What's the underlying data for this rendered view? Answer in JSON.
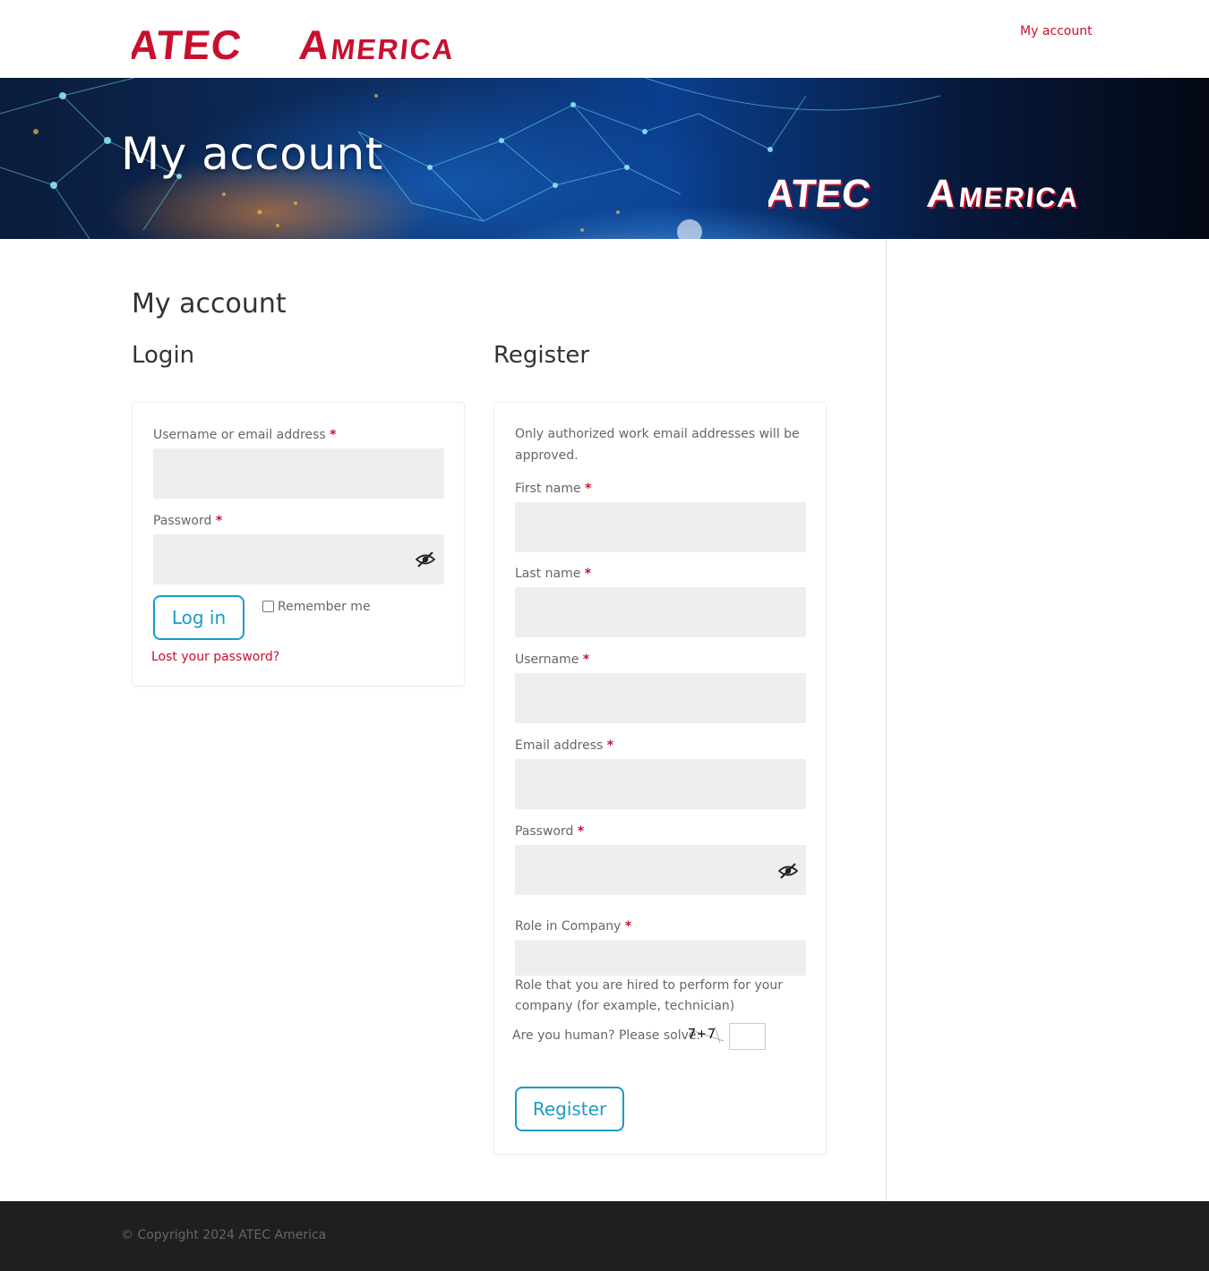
{
  "brand": {
    "name": "ATEC America",
    "logo_color": "#c8102e"
  },
  "header": {
    "nav": [
      {
        "label": "My account"
      }
    ]
  },
  "hero": {
    "title": "My account"
  },
  "page": {
    "title": "My account"
  },
  "login": {
    "heading": "Login",
    "username_label": "Username or email address",
    "password_label": "Password",
    "required_mark": "*",
    "login_button": "Log in",
    "remember_label": "Remember me",
    "lost_password": "Lost your password?"
  },
  "register": {
    "heading": "Register",
    "notice": "Only authorized work email addresses will be approved.",
    "first_name_label": "First name",
    "last_name_label": "Last name",
    "username_label": "Username",
    "email_label": "Email address",
    "password_label": "Password",
    "role_label": "Role in Company",
    "role_help": "Role that you are hired to perform for your company (for example, technician)",
    "captcha_label": "Are you human? Please solve:",
    "captcha_text": "7+7",
    "register_button": "Register"
  },
  "footer": {
    "copyright": "© Copyright 2024 ATEC America"
  },
  "colors": {
    "accent": "#c8102e",
    "button": "#1a9bc7",
    "footer_bg": "#1f1f1f",
    "field_bg": "#eeeeee"
  }
}
